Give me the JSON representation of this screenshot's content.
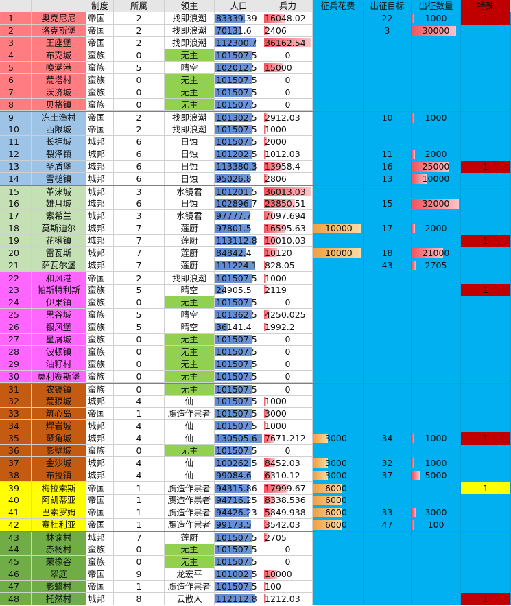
{
  "headers": {
    "index": "",
    "name": "",
    "system": "制度",
    "owner": "所属",
    "lord": "领主",
    "population": "人口",
    "troops": "兵力",
    "recruit_cost": "征兵花费",
    "target": "出征目标",
    "expedition": "出征数量",
    "special": "特殊"
  },
  "colors": {
    "header_bg": "#e6e6e6",
    "sky": "#00b0f0",
    "no_lord_green": "#92d050",
    "special_red": "#c00000",
    "special_yellow": "#ffff00",
    "group1": "#ff7c80",
    "group2": "#9dc3e6",
    "group3": "#c5e0b4",
    "group4": "#ff66ff",
    "group5": "#c55a11",
    "group6": "#ffff00",
    "group7": "#70ad47"
  },
  "maxima": {
    "population": 130505.6,
    "troops": 36162.54,
    "recruit_cost": 10000,
    "expedition": 32000
  },
  "rows": [
    {
      "i": "1",
      "name": "奥克尼尼",
      "g": 1,
      "sys": "帝国",
      "own": "2",
      "lord": "找即浪潮",
      "pop": "83339.39",
      "popv": 83339.39,
      "tr": "16048.02",
      "trv": 16048.02,
      "cost": "",
      "costv": 0,
      "tgt": "22",
      "exp": "1000",
      "expv": 1000,
      "sp": "1",
      "spc": "red"
    },
    {
      "i": "2",
      "name": "洛克斯堡",
      "g": 1,
      "sys": "帝国",
      "own": "2",
      "lord": "找即浪潮",
      "pop": "70131.6",
      "popv": 70131.6,
      "tr": "2406",
      "trv": 2406,
      "cost": "",
      "costv": 0,
      "tgt": "3",
      "exp": "30000",
      "expv": 30000,
      "sp": "",
      "spc": ""
    },
    {
      "i": "3",
      "name": "王座堡",
      "g": 1,
      "sys": "帝国",
      "own": "2",
      "lord": "找即浪潮",
      "pop": "112300.7",
      "popv": 112300.7,
      "tr": "36162.54",
      "trv": 36162.54,
      "cost": "",
      "costv": 0,
      "tgt": "",
      "exp": "",
      "expv": 0,
      "sp": "",
      "spc": ""
    },
    {
      "i": "4",
      "name": "布克城",
      "g": 1,
      "sys": "蛮族",
      "own": "0",
      "lord": "无主",
      "pop": "101507.5",
      "popv": 101507.5,
      "tr": "0",
      "trv": 0,
      "cost": "",
      "costv": 0,
      "tgt": "",
      "exp": "",
      "expv": 0,
      "sp": "",
      "spc": ""
    },
    {
      "i": "5",
      "name": "唤潮港",
      "g": 1,
      "sys": "蛮族",
      "own": "5",
      "lord": "晴空",
      "pop": "102012.5",
      "popv": 102012.5,
      "tr": "15000",
      "trv": 15000,
      "cost": "",
      "costv": 0,
      "tgt": "",
      "exp": "",
      "expv": 0,
      "sp": "",
      "spc": ""
    },
    {
      "i": "6",
      "name": "荒塔村",
      "g": 1,
      "sys": "蛮族",
      "own": "0",
      "lord": "无主",
      "pop": "101507.5",
      "popv": 101507.5,
      "tr": "0",
      "trv": 0,
      "cost": "",
      "costv": 0,
      "tgt": "",
      "exp": "",
      "expv": 0,
      "sp": "",
      "spc": ""
    },
    {
      "i": "7",
      "name": "沃济城",
      "g": 1,
      "sys": "蛮族",
      "own": "0",
      "lord": "无主",
      "pop": "101507.5",
      "popv": 101507.5,
      "tr": "0",
      "trv": 0,
      "cost": "",
      "costv": 0,
      "tgt": "",
      "exp": "",
      "expv": 0,
      "sp": "",
      "spc": ""
    },
    {
      "i": "8",
      "name": "贝格镇",
      "g": 1,
      "sys": "蛮族",
      "own": "0",
      "lord": "无主",
      "pop": "101507.5",
      "popv": 101507.5,
      "tr": "0",
      "trv": 0,
      "cost": "",
      "costv": 0,
      "tgt": "",
      "exp": "",
      "expv": 0,
      "sp": "",
      "spc": ""
    },
    {
      "i": "9",
      "name": "冻土渔村",
      "g": 2,
      "sys": "帝国",
      "own": "2",
      "lord": "找即浪潮",
      "pop": "101302.5",
      "popv": 101302.5,
      "tr": "2912.03",
      "trv": 2912.03,
      "cost": "",
      "costv": 0,
      "tgt": "10",
      "exp": "1000",
      "expv": 1000,
      "sp": "",
      "spc": ""
    },
    {
      "i": "10",
      "name": "西限城",
      "g": 2,
      "sys": "帝国",
      "own": "2",
      "lord": "找即浪潮",
      "pop": "101507.5",
      "popv": 101507.5,
      "tr": "1000",
      "trv": 1000,
      "cost": "",
      "costv": 0,
      "tgt": "",
      "exp": "",
      "expv": 0,
      "sp": "",
      "spc": ""
    },
    {
      "i": "11",
      "name": "长拥城",
      "g": 2,
      "sys": "城邦",
      "own": "6",
      "lord": "日蚀",
      "pop": "101507.5",
      "popv": 101507.5,
      "tr": "2000",
      "trv": 2000,
      "cost": "",
      "costv": 0,
      "tgt": "",
      "exp": "",
      "expv": 0,
      "sp": "",
      "spc": ""
    },
    {
      "i": "12",
      "name": "裂泽镇",
      "g": 2,
      "sys": "城邦",
      "own": "6",
      "lord": "日蚀",
      "pop": "101202.5",
      "popv": 101202.5,
      "tr": "1012.03",
      "trv": 1012.03,
      "cost": "",
      "costv": 0,
      "tgt": "11",
      "exp": "2000",
      "expv": 2000,
      "sp": "",
      "spc": ""
    },
    {
      "i": "13",
      "name": "圣盾堡",
      "g": 2,
      "sys": "城邦",
      "own": "6",
      "lord": "日蚀",
      "pop": "113380.3",
      "popv": 113380.3,
      "tr": "13958.4",
      "trv": 13958.4,
      "cost": "",
      "costv": 0,
      "tgt": "16",
      "exp": "25000",
      "expv": 25000,
      "sp": "1",
      "spc": "red"
    },
    {
      "i": "14",
      "name": "雪槌镇",
      "g": 2,
      "sys": "城邦",
      "own": "6",
      "lord": "日蚀",
      "pop": "95026.8",
      "popv": 95026.8,
      "tr": "2806",
      "trv": 2806,
      "cost": "",
      "costv": 0,
      "tgt": "13",
      "exp": "10000",
      "expv": 10000,
      "sp": "",
      "spc": ""
    },
    {
      "i": "15",
      "name": "革涞城",
      "g": 3,
      "sys": "城邦",
      "own": "3",
      "lord": "水镜君",
      "pop": "101201.5",
      "popv": 101201.5,
      "tr": "36013.03",
      "trv": 36013.03,
      "cost": "",
      "costv": 0,
      "tgt": "",
      "exp": "",
      "expv": 0,
      "sp": "",
      "spc": ""
    },
    {
      "i": "16",
      "name": "雄月城",
      "g": 3,
      "sys": "城邦",
      "own": "6",
      "lord": "日蚀",
      "pop": "102896.7",
      "popv": 102896.7,
      "tr": "23850.51",
      "trv": 23850.51,
      "cost": "",
      "costv": 0,
      "tgt": "15",
      "exp": "32000",
      "expv": 32000,
      "sp": "",
      "spc": ""
    },
    {
      "i": "17",
      "name": "索希兰",
      "g": 3,
      "sys": "城邦",
      "own": "3",
      "lord": "水镜君",
      "pop": "97777.7",
      "popv": 97777.7,
      "tr": "7097.694",
      "trv": 7097.694,
      "cost": "",
      "costv": 0,
      "tgt": "",
      "exp": "",
      "expv": 0,
      "sp": "",
      "spc": ""
    },
    {
      "i": "18",
      "name": "莫斯迪尔",
      "g": 3,
      "sys": "城邦",
      "own": "7",
      "lord": "莲厨",
      "pop": "97801.5",
      "popv": 97801.5,
      "tr": "16595.63",
      "trv": 16595.63,
      "cost": "10000",
      "costv": 10000,
      "tgt": "17",
      "exp": "2000",
      "expv": 2000,
      "sp": "",
      "spc": ""
    },
    {
      "i": "19",
      "name": "花楸镇",
      "g": 3,
      "sys": "城邦",
      "own": "7",
      "lord": "莲厨",
      "pop": "113112.8",
      "popv": 113112.8,
      "tr": "10010.03",
      "trv": 10010.03,
      "cost": "",
      "costv": 0,
      "tgt": "",
      "exp": "",
      "expv": 0,
      "sp": "1",
      "spc": "red"
    },
    {
      "i": "20",
      "name": "雷瓦斯",
      "g": 3,
      "sys": "城邦",
      "own": "7",
      "lord": "莲厨",
      "pop": "84842.4",
      "popv": 84842.4,
      "tr": "10120",
      "trv": 10120,
      "cost": "10000",
      "costv": 10000,
      "tgt": "18",
      "exp": "21000",
      "expv": 21000,
      "sp": "",
      "spc": ""
    },
    {
      "i": "21",
      "name": "萨瓦尔堡",
      "g": 3,
      "sys": "城邦",
      "own": "7",
      "lord": "莲厨",
      "pop": "111224.1",
      "popv": 111224.1,
      "tr": "828.05",
      "trv": 828.05,
      "cost": "",
      "costv": 0,
      "tgt": "43",
      "exp": "2705",
      "expv": 2705,
      "sp": "",
      "spc": ""
    },
    {
      "i": "22",
      "name": "和风港",
      "g": 4,
      "sys": "帝国",
      "own": "2",
      "lord": "找即浪潮",
      "pop": "101507.5",
      "popv": 101507.5,
      "tr": "1000",
      "trv": 1000,
      "cost": "",
      "costv": 0,
      "tgt": "",
      "exp": "",
      "expv": 0,
      "sp": "",
      "spc": ""
    },
    {
      "i": "23",
      "name": "帕斯特利斯",
      "g": 4,
      "sys": "蛮族",
      "own": "5",
      "lord": "晴空",
      "pop": "24905.5",
      "popv": 24905.5,
      "tr": "2119",
      "trv": 2119,
      "cost": "",
      "costv": 0,
      "tgt": "",
      "exp": "",
      "expv": 0,
      "sp": "1",
      "spc": "red"
    },
    {
      "i": "24",
      "name": "伊果镇",
      "g": 4,
      "sys": "蛮族",
      "own": "0",
      "lord": "无主",
      "pop": "101507.5",
      "popv": 101507.5,
      "tr": "0",
      "trv": 0,
      "cost": "",
      "costv": 0,
      "tgt": "",
      "exp": "",
      "expv": 0,
      "sp": "",
      "spc": ""
    },
    {
      "i": "25",
      "name": "黑谷城",
      "g": 4,
      "sys": "蛮族",
      "own": "5",
      "lord": "晴空",
      "pop": "101362.5",
      "popv": 101362.5,
      "tr": "4250.025",
      "trv": 4250.025,
      "cost": "",
      "costv": 0,
      "tgt": "",
      "exp": "",
      "expv": 0,
      "sp": "",
      "spc": ""
    },
    {
      "i": "26",
      "name": "银风堡",
      "g": 4,
      "sys": "蛮族",
      "own": "5",
      "lord": "晴空",
      "pop": "36141.4",
      "popv": 36141.4,
      "tr": "1992.2",
      "trv": 1992.2,
      "cost": "",
      "costv": 0,
      "tgt": "",
      "exp": "",
      "expv": 0,
      "sp": "",
      "spc": ""
    },
    {
      "i": "27",
      "name": "星屑城",
      "g": 4,
      "sys": "蛮族",
      "own": "0",
      "lord": "无主",
      "pop": "101507.5",
      "popv": 101507.5,
      "tr": "0",
      "trv": 0,
      "cost": "",
      "costv": 0,
      "tgt": "",
      "exp": "",
      "expv": 0,
      "sp": "",
      "spc": ""
    },
    {
      "i": "28",
      "name": "波顿镇",
      "g": 4,
      "sys": "蛮族",
      "own": "0",
      "lord": "无主",
      "pop": "101507.5",
      "popv": 101507.5,
      "tr": "0",
      "trv": 0,
      "cost": "",
      "costv": 0,
      "tgt": "",
      "exp": "",
      "expv": 0,
      "sp": "",
      "spc": ""
    },
    {
      "i": "29",
      "name": "油籽村",
      "g": 4,
      "sys": "蛮族",
      "own": "0",
      "lord": "无主",
      "pop": "101507.5",
      "popv": 101507.5,
      "tr": "0",
      "trv": 0,
      "cost": "",
      "costv": 0,
      "tgt": "",
      "exp": "",
      "expv": 0,
      "sp": "",
      "spc": ""
    },
    {
      "i": "30",
      "name": "莫利赛斯堡",
      "g": 4,
      "sys": "蛮族",
      "own": "0",
      "lord": "无主",
      "pop": "101507.5",
      "popv": 101507.5,
      "tr": "0",
      "trv": 0,
      "cost": "",
      "costv": 0,
      "tgt": "",
      "exp": "",
      "expv": 0,
      "sp": "",
      "spc": ""
    },
    {
      "i": "31",
      "name": "农镐镇",
      "g": 5,
      "sys": "蛮族",
      "own": "0",
      "lord": "无主",
      "pop": "101507.5",
      "popv": 101507.5,
      "tr": "0",
      "trv": 0,
      "cost": "",
      "costv": 0,
      "tgt": "",
      "exp": "",
      "expv": 0,
      "sp": "",
      "spc": ""
    },
    {
      "i": "32",
      "name": "荒狼城",
      "g": 5,
      "sys": "城邦",
      "own": "4",
      "lord": "仙",
      "pop": "101507.5",
      "popv": 101507.5,
      "tr": "1000",
      "trv": 1000,
      "cost": "",
      "costv": 0,
      "tgt": "",
      "exp": "",
      "expv": 0,
      "sp": "",
      "spc": ""
    },
    {
      "i": "33",
      "name": "筑心岛",
      "g": 5,
      "sys": "帝国",
      "own": "1",
      "lord": "赝造作祟者",
      "pop": "101507.5",
      "popv": 101507.5,
      "tr": "3000",
      "trv": 3000,
      "cost": "",
      "costv": 0,
      "tgt": "",
      "exp": "",
      "expv": 0,
      "sp": "",
      "spc": ""
    },
    {
      "i": "34",
      "name": "焊岩城",
      "g": 5,
      "sys": "城邦",
      "own": "4",
      "lord": "仙",
      "pop": "101507.5",
      "popv": 101507.5,
      "tr": "1000",
      "trv": 1000,
      "cost": "",
      "costv": 0,
      "tgt": "",
      "exp": "",
      "expv": 0,
      "sp": "",
      "spc": ""
    },
    {
      "i": "35",
      "name": "鼙角城",
      "g": 5,
      "sys": "城邦",
      "own": "4",
      "lord": "仙",
      "pop": "130505.6",
      "popv": 130505.6,
      "tr": "7671.212",
      "trv": 7671.212,
      "cost": "3000",
      "costv": 3000,
      "tgt": "34",
      "exp": "1000",
      "expv": 1000,
      "sp": "1",
      "spc": "red"
    },
    {
      "i": "36",
      "name": "影壁城",
      "g": 5,
      "sys": "蛮族",
      "own": "0",
      "lord": "无主",
      "pop": "101507.5",
      "popv": 101507.5,
      "tr": "0",
      "trv": 0,
      "cost": "",
      "costv": 0,
      "tgt": "",
      "exp": "",
      "expv": 0,
      "sp": "",
      "spc": ""
    },
    {
      "i": "37",
      "name": "金沙城",
      "g": 5,
      "sys": "城邦",
      "own": "4",
      "lord": "仙",
      "pop": "100262.5",
      "popv": 100262.5,
      "tr": "8452.03",
      "trv": 8452.03,
      "cost": "3000",
      "costv": 3000,
      "tgt": "32",
      "exp": "1000",
      "expv": 1000,
      "sp": "",
      "spc": ""
    },
    {
      "i": "38",
      "name": "布拉镇",
      "g": 5,
      "sys": "城邦",
      "own": "4",
      "lord": "仙",
      "pop": "99084.6",
      "popv": 99084.6,
      "tr": "6310.12",
      "trv": 6310.12,
      "cost": "3000",
      "costv": 3000,
      "tgt": "37",
      "exp": "5000",
      "expv": 5000,
      "sp": "",
      "spc": ""
    },
    {
      "i": "39",
      "name": "梅拉索斯",
      "g": 6,
      "sys": "帝国",
      "own": "1",
      "lord": "赝造作祟者",
      "pop": "94315.86",
      "popv": 94315.86,
      "tr": "17999.67",
      "trv": 17999.67,
      "cost": "6000",
      "costv": 6000,
      "tgt": "",
      "exp": "",
      "expv": 0,
      "sp": "1",
      "spc": "yellow"
    },
    {
      "i": "40",
      "name": "阿凯蒂亚",
      "g": 6,
      "sys": "帝国",
      "own": "1",
      "lord": "赝造作祟者",
      "pop": "94716.25",
      "popv": 94716.25,
      "tr": "8338.536",
      "trv": 8338.536,
      "cost": "6000",
      "costv": 6000,
      "tgt": "",
      "exp": "",
      "expv": 0,
      "sp": "",
      "spc": ""
    },
    {
      "i": "41",
      "name": "巴索罗姆",
      "g": 6,
      "sys": "帝国",
      "own": "1",
      "lord": "赝造作祟者",
      "pop": "94426.23",
      "popv": 94426.23,
      "tr": "5849.938",
      "trv": 5849.938,
      "cost": "6000",
      "costv": 6000,
      "tgt": "33",
      "exp": "3000",
      "expv": 3000,
      "sp": "",
      "spc": ""
    },
    {
      "i": "42",
      "name": "赛杜利亚",
      "g": 6,
      "sys": "帝国",
      "own": "1",
      "lord": "赝造作祟者",
      "pop": "99173.5",
      "popv": 99173.5,
      "tr": "3542.03",
      "trv": 3542.03,
      "cost": "6000",
      "costv": 6000,
      "tgt": "47",
      "exp": "100",
      "expv": 100,
      "sp": "",
      "spc": ""
    },
    {
      "i": "43",
      "name": "林谕村",
      "g": 7,
      "sys": "城邦",
      "own": "7",
      "lord": "莲厨",
      "pop": "101507.5",
      "popv": 101507.5,
      "tr": "2705",
      "trv": 2705,
      "cost": "",
      "costv": 0,
      "tgt": "",
      "exp": "",
      "expv": 0,
      "sp": "",
      "spc": ""
    },
    {
      "i": "44",
      "name": "赤杨村",
      "g": 7,
      "sys": "蛮族",
      "own": "0",
      "lord": "无主",
      "pop": "101507.5",
      "popv": 101507.5,
      "tr": "0",
      "trv": 0,
      "cost": "",
      "costv": 0,
      "tgt": "",
      "exp": "",
      "expv": 0,
      "sp": "",
      "spc": ""
    },
    {
      "i": "45",
      "name": "荣橡谷",
      "g": 7,
      "sys": "蛮族",
      "own": "0",
      "lord": "无主",
      "pop": "101507.5",
      "popv": 101507.5,
      "tr": "0",
      "trv": 0,
      "cost": "",
      "costv": 0,
      "tgt": "",
      "exp": "",
      "expv": 0,
      "sp": "",
      "spc": ""
    },
    {
      "i": "46",
      "name": "翠庭",
      "g": 7,
      "sys": "帝国",
      "own": "9",
      "lord": "龙宏平",
      "pop": "101002.5",
      "popv": 101002.5,
      "tr": "10000",
      "trv": 10000,
      "cost": "",
      "costv": 0,
      "tgt": "",
      "exp": "",
      "expv": 0,
      "sp": "",
      "spc": ""
    },
    {
      "i": "47",
      "name": "影蜡村",
      "g": 7,
      "sys": "帝国",
      "own": "1",
      "lord": "赝造作祟者",
      "pop": "101507.5",
      "popv": 101507.5,
      "tr": "100",
      "trv": 100,
      "cost": "",
      "costv": 0,
      "tgt": "",
      "exp": "",
      "expv": 0,
      "sp": "",
      "spc": ""
    },
    {
      "i": "48",
      "name": "托然村",
      "g": 7,
      "sys": "城邦",
      "own": "8",
      "lord": "云散人",
      "pop": "112112.8",
      "popv": 112112.8,
      "tr": "1212.03",
      "trv": 1212.03,
      "cost": "",
      "costv": 0,
      "tgt": "",
      "exp": "",
      "expv": 0,
      "sp": "1",
      "spc": "red"
    }
  ]
}
